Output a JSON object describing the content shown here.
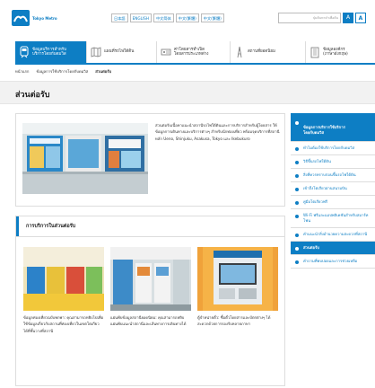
{
  "header": {
    "logo_text": "Tokyo Metro",
    "languages": [
      "日本語",
      "ENGLISH",
      "中文简体",
      "中文(繁體)",
      "中文(繁體)"
    ],
    "search_placeholder": "ปุ่มค้นหาคำเพื่อค้น",
    "font_small": "A",
    "font_large": "A"
  },
  "nav": {
    "items": [
      {
        "label": "ข้อมูลบริการสำหรับ\nบริการโดยกับดมวิส",
        "active": true,
        "icon": "train-icon"
      },
      {
        "label": "แผนที่รถไฟใต้ดิน",
        "active": false,
        "icon": "map-icon"
      },
      {
        "label": "ค่าโดยสารทำเปิด\nโดยสารประเภทต่าง",
        "active": false,
        "icon": "ticket-icon"
      },
      {
        "label": "สถานที่ยอดนิยม",
        "active": false,
        "icon": "tower-icon"
      },
      {
        "label": "ข้อมูลองค์กร\n(ภาษาอังกฤษ)",
        "active": false,
        "icon": "building-icon"
      }
    ]
  },
  "breadcrumb": {
    "items": [
      "หน้าแรก",
      "ข้อมูลการใช้บริการโดยกับดมวิส",
      "ส่วนต่อรับ"
    ]
  },
  "page_title": "ส่วนต่อรับ",
  "intro": {
    "text": "ส่วนต่อรับเนื้อหาแนะนำสถานีรถไฟใต้ดินและการบริการสำหรับผู้โดยสาร ให้ข้อมูลการเดินทางและบริการต่างๆ สำหรับนักท่องเที่ยว พร้อมจุดบริการที่สถานีหลัก Ueno, Shinjuku, Asakusa, Tokyo และ Ikebukuro"
  },
  "services": {
    "heading": "การบริการในส่วนต่อรับ",
    "cards": [
      {
        "text": "ข้อมูลท่องเที่ยวฉบับพกพา: คุณสามารถหยิบไปเพื่อใช้ข้อมูลเกี่ยวกับสถานที่ท่องเที่ยวในเขตโตเกียวได้ที่ชั้นวางที่สถานี"
      },
      {
        "text": "แผ่นพับข้อมูลสถานียอดนิยม: คุณสามารถหยิบแผ่นพับแนะนำสถานีและเส้นทางการเดินทางได้"
      },
      {
        "text": "ตู้จำหน่ายตั๋ว: ซื้อตั๋วโดยสารและบัตรต่างๆ ได้สะดวกด้วยการรองรับหลายภาษา"
      }
    ]
  },
  "sidebar": {
    "items": [
      {
        "label": "ข้อมูลการบริการใช้บริการ\nโดยกับดมวิส",
        "kind": "head"
      },
      {
        "label": "ทำไมต้องใช้บริการโดยกับดมวิส",
        "kind": "normal"
      },
      {
        "label": "วิธีขึ้นรถไฟใต้ดิน",
        "kind": "normal"
      },
      {
        "label": "สิ่งที่ควรทราบก่อนขึ้นรถไฟใต้ดิน",
        "kind": "normal"
      },
      {
        "label": "เข้าถึงโตเกียวผ่านสนามบิน",
        "kind": "normal"
      },
      {
        "label": "คู่มือโตเกียวฟรี",
        "kind": "normal"
      },
      {
        "label": "Wi-Fi ฟรีและแอปพลิเคชันสำหรับสมาร์ทโฟน",
        "kind": "normal"
      },
      {
        "label": "คำแนะนำสิ่งอำนวยความสะดวกที่สถานี",
        "kind": "normal"
      },
      {
        "label": "ส่วนต่อรับ",
        "kind": "sel"
      },
      {
        "label": "คำถามที่พบบ่อยและการช่วยเหลือ",
        "kind": "normal"
      }
    ]
  },
  "colors": {
    "accent": "#0d7ec4"
  }
}
